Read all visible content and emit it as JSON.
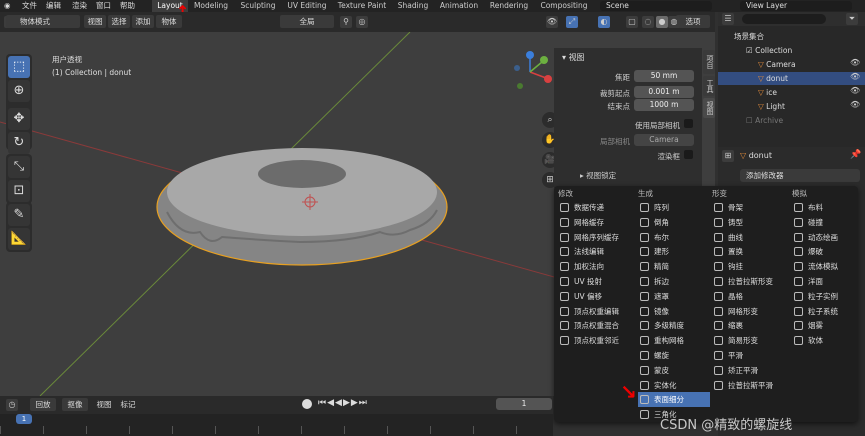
{
  "topbar": {
    "menus": [
      "文件",
      "编辑",
      "渲染",
      "窗口",
      "帮助"
    ],
    "workspaces": [
      "Layout",
      "Modeling",
      "Sculpting",
      "UV Editing",
      "Texture Paint",
      "Shading",
      "Animation",
      "Rendering",
      "Compositing"
    ],
    "active_workspace": "Layout",
    "scene": "Scene",
    "view_layer": "View Layer"
  },
  "header": {
    "mode": "物体模式",
    "menus": [
      "视图",
      "选择",
      "添加",
      "物体"
    ],
    "transform": "全局",
    "options": "选项"
  },
  "viewport": {
    "view_name": "用户透视",
    "collection_info": "(1) Collection | donut",
    "gizmo_labels": {
      "x": "X",
      "y": "Y",
      "z": "Z"
    }
  },
  "npanel": {
    "section": "视图",
    "focal_label": "焦距",
    "focal_value": "50 mm",
    "clip_start_label": "裁剪起点",
    "clip_start_value": "0.001 m",
    "clip_end_label": "结束点",
    "clip_end_value": "1000 m",
    "local_camera_label": "使用局部相机",
    "local_cam_label": "局部相机",
    "camera_value": "Camera",
    "render_border_label": "渲染框",
    "view_lock": "视图锁定",
    "tabs": [
      "项目",
      "工具",
      "视图"
    ]
  },
  "outliner": {
    "root": "场景集合",
    "items": [
      {
        "name": "Collection",
        "depth": 1
      },
      {
        "name": "Camera",
        "depth": 2
      },
      {
        "name": "donut",
        "depth": 2
      },
      {
        "name": "ice",
        "depth": 2
      },
      {
        "name": "Light",
        "depth": 2
      },
      {
        "name": "Archive",
        "depth": 1
      }
    ],
    "selected": "donut"
  },
  "properties": {
    "object_name": "donut",
    "add_modifier": "添加修改器"
  },
  "modifier_menu": {
    "columns": [
      {
        "header": "修改",
        "items": [
          "数据传递",
          "网格缓存",
          "网格序列缓存",
          "法线编辑",
          "加权法向",
          "UV 投射",
          "UV 偏移",
          "顶点权重编辑",
          "顶点权重混合",
          "顶点权重邻近"
        ]
      },
      {
        "header": "生成",
        "items": [
          "阵列",
          "倒角",
          "布尔",
          "建形",
          "精简",
          "拆边",
          "遮罩",
          "镜像",
          "多级精度",
          "重构网格",
          "螺旋",
          "蒙皮",
          "实体化",
          "表面细分",
          "三角化"
        ]
      },
      {
        "header": "形变",
        "items": [
          "骨架",
          "铸型",
          "曲线",
          "置换",
          "钩挂",
          "拉普拉斯形变",
          "晶格",
          "网格形变",
          "缩裹",
          "简易形变",
          "平滑",
          "矫正平滑",
          "拉普拉斯平滑"
        ]
      },
      {
        "header": "模拟",
        "items": [
          "布料",
          "碰撞",
          "动态绘画",
          "爆破",
          "流体模拟",
          "洋面",
          "粒子实例",
          "粒子系统",
          "烟雾",
          "软体"
        ]
      }
    ],
    "highlighted": "表面细分"
  },
  "timeline": {
    "playback": "回放",
    "keying": "抠像",
    "view": "视图",
    "markers": "标记",
    "current_frame": "1",
    "ruler_start": "1"
  },
  "watermark": "CSDN @精致的螺旋线",
  "colors": {
    "accent": "#4772b3",
    "selection": "#e8a020",
    "annotation": "#e00000"
  }
}
